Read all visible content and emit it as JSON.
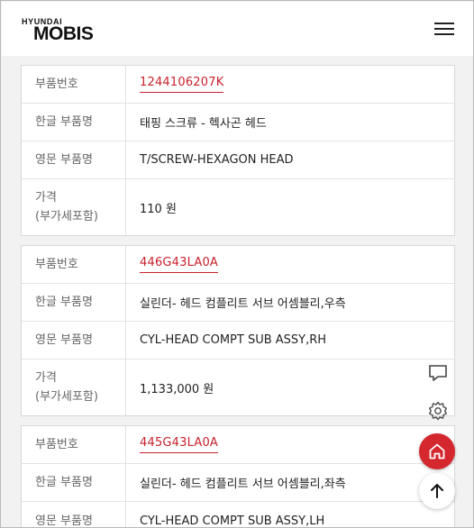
{
  "brand": {
    "small": "HYUNDAI",
    "big": "MOBIS"
  },
  "labels": {
    "part_no": "부품번호",
    "kor_name": "한글 부품명",
    "eng_name": "영문 부품명",
    "price_1": "가격",
    "price_2": "(부가세포함)"
  },
  "parts": [
    {
      "part_no": "1244106207K",
      "kor_name": "태핑 스크류 - 헥사곤 헤드",
      "eng_name": "T/SCREW-HEXAGON HEAD",
      "price": "110 원"
    },
    {
      "part_no": "446G43LA0A",
      "kor_name": "실린더- 헤드 컴플리트 서브 어셈블리,우측",
      "eng_name": "CYL-HEAD COMPT SUB ASSY,RH",
      "price": "1,133,000 원"
    },
    {
      "part_no": "445G43LA0A",
      "kor_name": "실린더- 헤드 컴플리트 서브 어셈블리,좌측",
      "eng_name": "CYL-HEAD COMPT SUB ASSY,LH"
    }
  ],
  "colors": {
    "accent": "#d4272e",
    "link": "#c8202b"
  },
  "icons": [
    "menu-icon",
    "chat-icon",
    "gear-icon",
    "home-icon",
    "arrow-up-icon"
  ]
}
